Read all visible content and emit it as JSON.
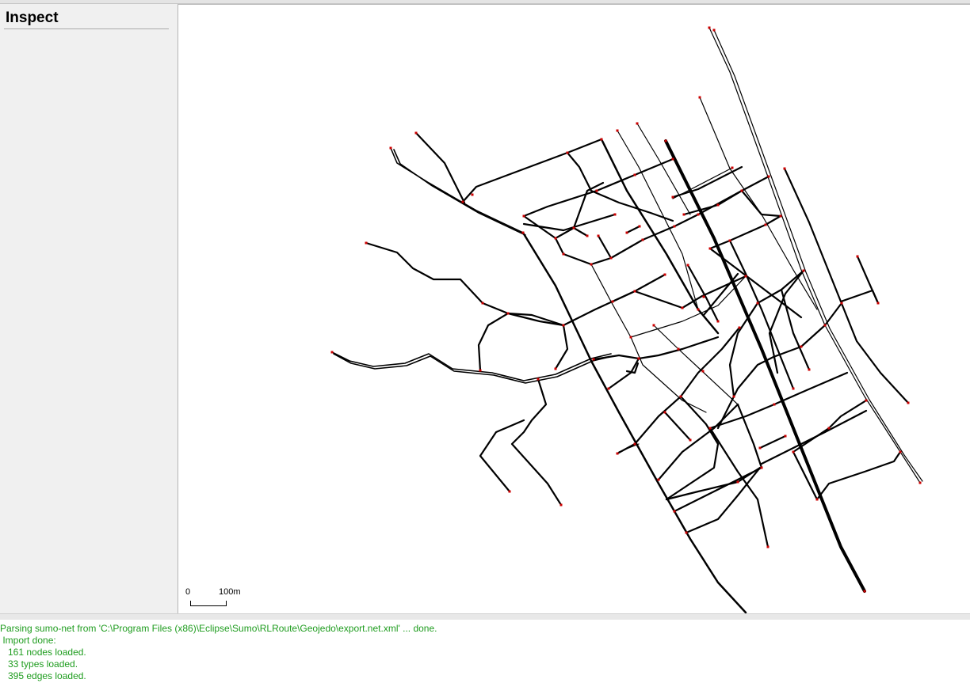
{
  "inspect_panel": {
    "title": "Inspect"
  },
  "canvas": {
    "background": "#ffffff",
    "road_color": "#000000",
    "junction_color": "#cc0000",
    "scale_bar": {
      "zero_label": "0",
      "distance_label": "100m"
    }
  },
  "log": {
    "text_color": "#1e9c1e",
    "lines": [
      "Parsing sumo-net from 'C:\\Program Files (x86)\\Eclipse\\Sumo\\RLRoute\\Geojedo\\export.net.xml' ... done.",
      " Import done:",
      "   161 nodes loaded.",
      "   33 types loaded.",
      "   395 edges loaded."
    ]
  }
}
